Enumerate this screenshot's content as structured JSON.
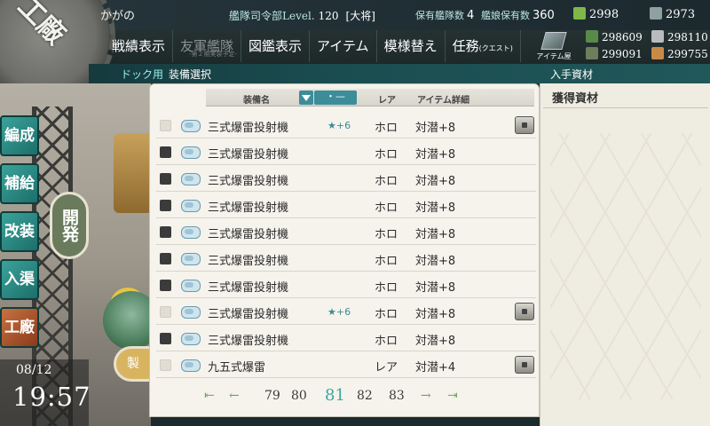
{
  "header": {
    "logo_text": "工廠",
    "player_name": "かがの",
    "hq_label": "艦隊司令部Level.",
    "hq_level": "120",
    "rank": "[大将]",
    "ships_label": "保有艦隊数",
    "ships_value": "4",
    "equip_label": "艦娘保有数",
    "equip_value": "360",
    "bucket": "2998",
    "devmat": "2973"
  },
  "menu": {
    "items": [
      {
        "label": "戦績表示",
        "sub": ""
      },
      {
        "label": "友軍艦隊",
        "sub": "-第２期実装予定-"
      },
      {
        "label": "図鑑表示",
        "sub": ""
      },
      {
        "label": "アイテム",
        "sub": ""
      },
      {
        "label": "模様替え",
        "sub": ""
      },
      {
        "label": "任務",
        "sub": "(クエスト)"
      }
    ],
    "item_shop": "アイテム屋"
  },
  "resources": {
    "fuel": "298609",
    "ammo": "299091",
    "steel": "298110",
    "bauxite": "299755"
  },
  "subbar": {
    "dock": "ドック用",
    "title": "装備選択",
    "right": "入手資材"
  },
  "sidebar": {
    "buttons": [
      "編成",
      "補給",
      "改装",
      "入渠",
      "工廠"
    ],
    "dev_button": "開発",
    "round_button": "製"
  },
  "datetime": {
    "date": "08/12",
    "time": "19:57"
  },
  "list": {
    "headers": {
      "name": "装備名",
      "rarity": "レア",
      "detail": "アイテム詳細"
    },
    "filter_label": "・—",
    "rows": [
      {
        "name": "三式爆雷投射機",
        "level": "★+6",
        "rarity": "ホロ",
        "stat": "対潜+8",
        "checked": false,
        "locked": true
      },
      {
        "name": "三式爆雷投射機",
        "level": "",
        "rarity": "ホロ",
        "stat": "対潜+8",
        "checked": true,
        "locked": false
      },
      {
        "name": "三式爆雷投射機",
        "level": "",
        "rarity": "ホロ",
        "stat": "対潜+8",
        "checked": true,
        "locked": false
      },
      {
        "name": "三式爆雷投射機",
        "level": "",
        "rarity": "ホロ",
        "stat": "対潜+8",
        "checked": true,
        "locked": false
      },
      {
        "name": "三式爆雷投射機",
        "level": "",
        "rarity": "ホロ",
        "stat": "対潜+8",
        "checked": true,
        "locked": false
      },
      {
        "name": "三式爆雷投射機",
        "level": "",
        "rarity": "ホロ",
        "stat": "対潜+8",
        "checked": true,
        "locked": false
      },
      {
        "name": "三式爆雷投射機",
        "level": "",
        "rarity": "ホロ",
        "stat": "対潜+8",
        "checked": true,
        "locked": false
      },
      {
        "name": "三式爆雷投射機",
        "level": "★+6",
        "rarity": "ホロ",
        "stat": "対潜+8",
        "checked": false,
        "locked": true
      },
      {
        "name": "三式爆雷投射機",
        "level": "",
        "rarity": "ホロ",
        "stat": "対潜+8",
        "checked": true,
        "locked": false
      },
      {
        "name": "九五式爆雷",
        "level": "",
        "rarity": "レア",
        "stat": "対潜+4",
        "checked": false,
        "locked": true
      }
    ]
  },
  "pager": {
    "pages": [
      "79",
      "80",
      "81",
      "82",
      "83"
    ],
    "current": "81"
  },
  "right_panel": {
    "title": "獲得資材"
  }
}
